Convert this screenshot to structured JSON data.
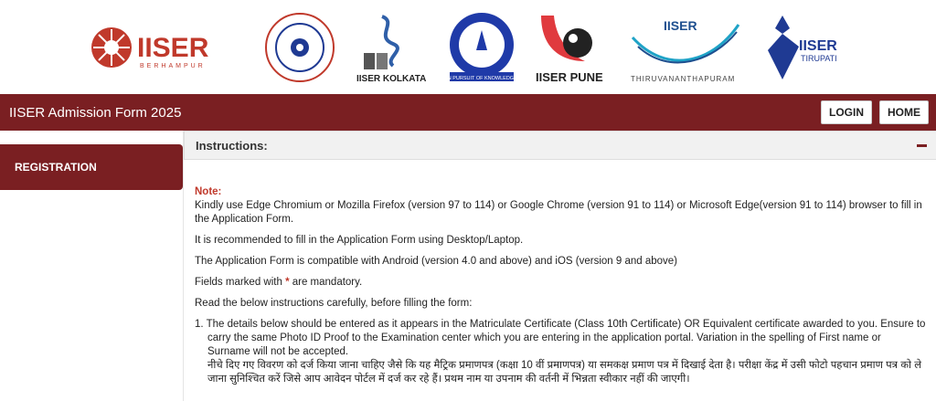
{
  "logos": [
    {
      "name": "iiser-berhampur-logo",
      "text": "IISER",
      "sub": "BERHAMPUR"
    },
    {
      "name": "iiser-bhopal-logo"
    },
    {
      "name": "iiser-kolkata-logo",
      "text": "IISER KOLKATA"
    },
    {
      "name": "iiser-mohali-logo",
      "sub": "IN PURSUIT OF KNOWLEDGE"
    },
    {
      "name": "iiser-pune-logo",
      "text": "IISER PUNE"
    },
    {
      "name": "iiser-tvm-logo",
      "text": "IISER",
      "sub": "THIRUVANANTHAPURAM"
    },
    {
      "name": "iiser-tirupati-logo",
      "text": "IISER",
      "sub": "TIRUPATI"
    }
  ],
  "header": {
    "title": "IISER Admission Form 2025",
    "login_label": "LOGIN",
    "home_label": "HOME"
  },
  "sidebar": {
    "items": [
      {
        "label": "REGISTRATION"
      }
    ]
  },
  "panel": {
    "title": "Instructions:"
  },
  "content": {
    "note_label": "Note:",
    "browser_text": "Kindly use Edge Chromium or Mozilla Firefox (version 97 to 114) or Google Chrome (version 91 to 114) or Microsoft Edge(version 91 to 114) browser to fill in the Application Form.",
    "desktop_text": "It is recommended to fill in the Application Form using Desktop/Laptop.",
    "compat_text": "The Application Form is compatible with Android (version 4.0 and above) and iOS (version 9 and above)",
    "mandatory_pre": "Fields marked with ",
    "mandatory_star": "*",
    "mandatory_post": " are mandatory.",
    "read_text": "Read the below instructions carefully, before filling the form:",
    "item1_en": "1. The details below should be entered as it appears in the Matriculate Certificate (Class 10th Certificate) OR Equivalent certificate awarded to you. Ensure to carry the same Photo ID Proof to the Examination center which you are entering in the application portal. Variation in the spelling of First name or Surname will not be accepted.",
    "item1_hi": "नीचे दिए गए विवरण को दर्ज किया जाना चाहिए जैसे कि यह मैट्रिक प्रमाणपत्र (कक्षा 10 वीं प्रमाणपत्र) या समकक्ष प्रमाण पत्र में दिखाई देता है। परीक्षा केंद्र में उसी फोटो पहचान प्रमाण पत्र को ले जाना सुनिश्चित करें जिसे आप आवेदन पोर्टल में दर्ज कर रहे हैं। प्रथम नाम या उपनाम की वर्तनी में भिन्नता स्वीकार नहीं की जाएगी।"
  },
  "colors": {
    "brand": "#7a1f22",
    "note": "#c0392b"
  }
}
